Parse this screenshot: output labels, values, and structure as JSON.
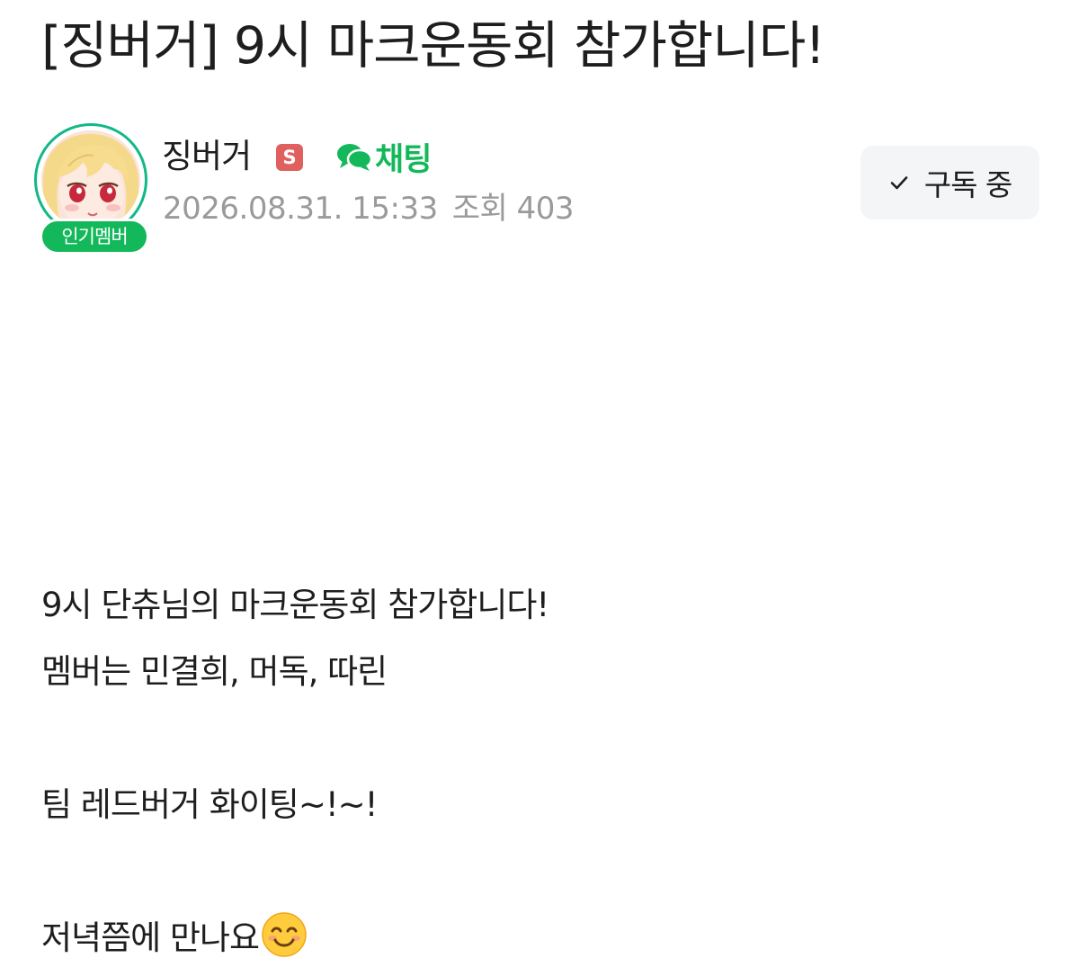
{
  "post": {
    "title": "[징버거] 9시 마크운동회 참가합니다!"
  },
  "author": {
    "name": "징버거",
    "badge_label": "인기멤버",
    "manager_badge": "S",
    "chat_label": "채팅",
    "date": "2026.08.31. 15:33",
    "views": "조회 403"
  },
  "subscribe": {
    "label": "구독 중"
  },
  "content": {
    "line1": "9시 단츄님의 마크운동회 참가합니다!",
    "line2": "멤버는 민결희, 머독, 따린",
    "line3": "팀 레드버거 화이팅~!~!",
    "line4": "저녁쯤에 만나요"
  },
  "icons": {
    "chat": "speech-bubbles-icon",
    "check": "check-icon",
    "emoji": "smiling-face-emoji"
  },
  "colors": {
    "accent_green": "#12b85a",
    "manager_red": "#e06060",
    "meta_gray": "#9a9a9a",
    "button_bg": "#f4f5f7"
  }
}
